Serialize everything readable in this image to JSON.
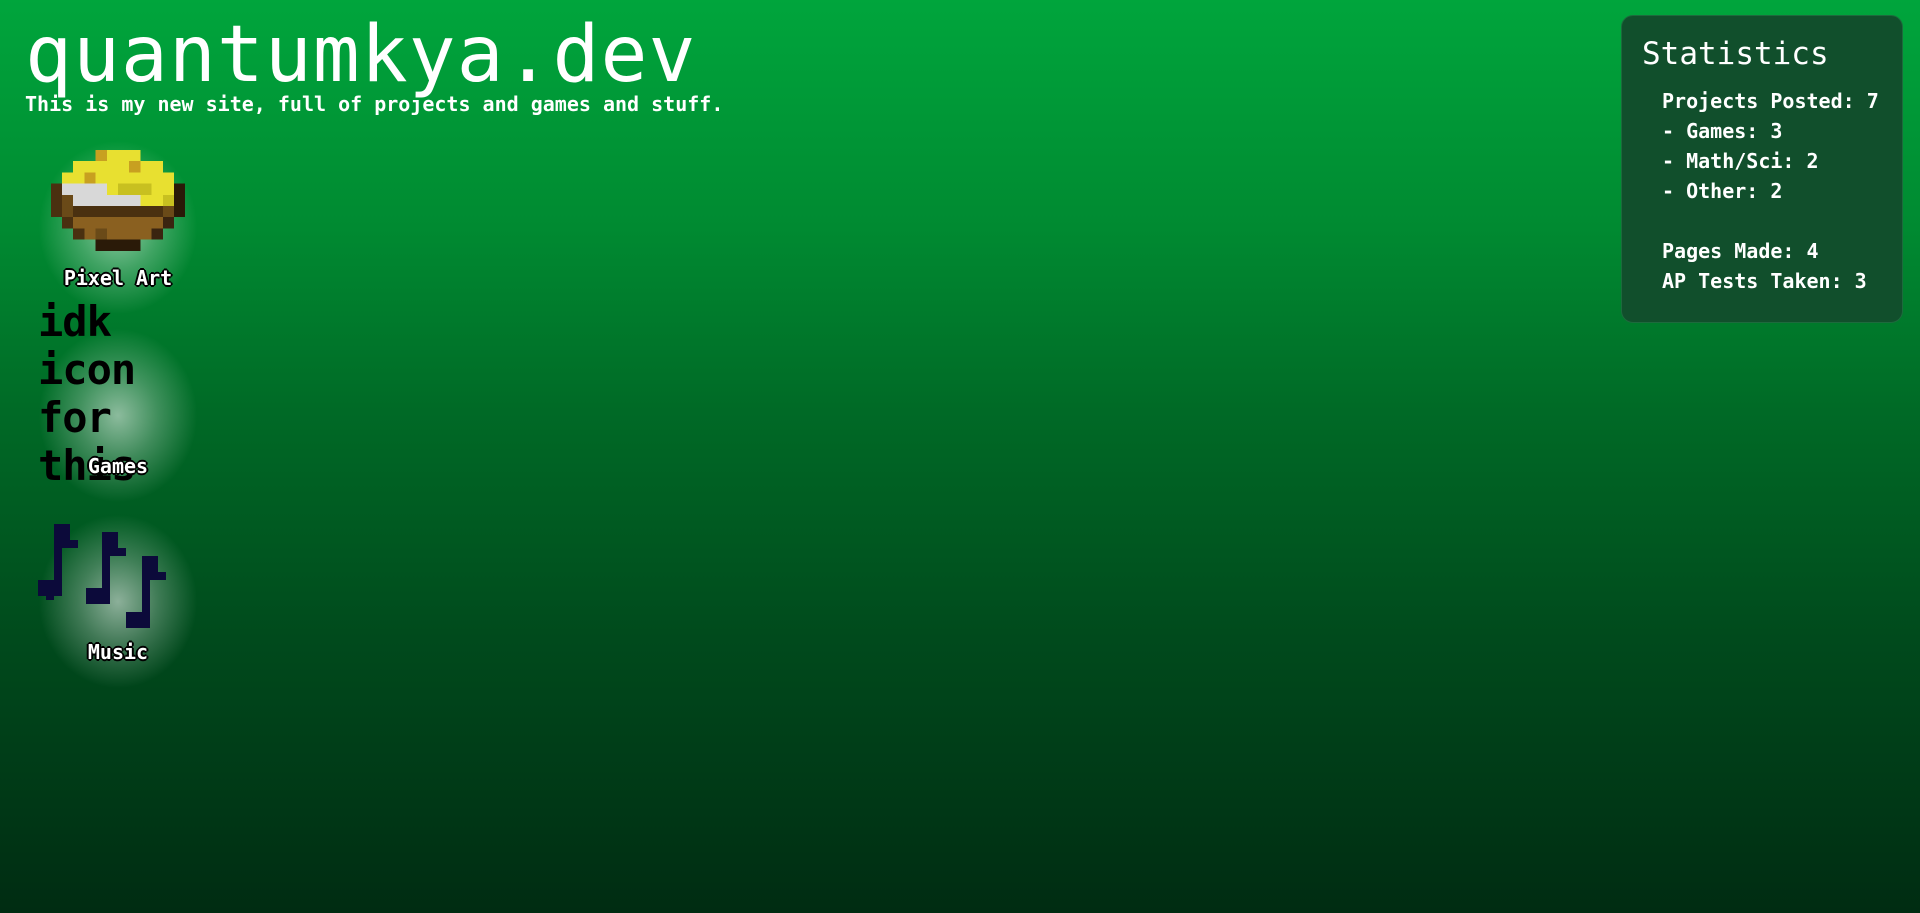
{
  "header": {
    "title": "quantumkya.dev",
    "subtitle": "This is my new site, full of projects and games and stuff."
  },
  "nav_icons": [
    {
      "label": "Pixel Art",
      "icon": "pixel-bowl-icon"
    },
    {
      "label": "Games",
      "icon": "idk-icon-for-this-text-icon",
      "icon_text_line1": "idk icon",
      "icon_text_line2": "for this"
    },
    {
      "label": "Music",
      "icon": "music-notes-icon"
    }
  ],
  "stats": {
    "title": "Statistics",
    "projects_posted": "Projects Posted: 7",
    "games": "- Games: 3",
    "math_sci": "- Math/Sci: 2",
    "other": "- Other: 2",
    "pages_made": "Pages Made: 4",
    "ap_tests": "AP Tests Taken: 3"
  },
  "colors": {
    "bg_top": "#00a53c",
    "bg_bottom": "#002c12",
    "panel": "#114f2c",
    "note_color": "#0c0a3a"
  }
}
